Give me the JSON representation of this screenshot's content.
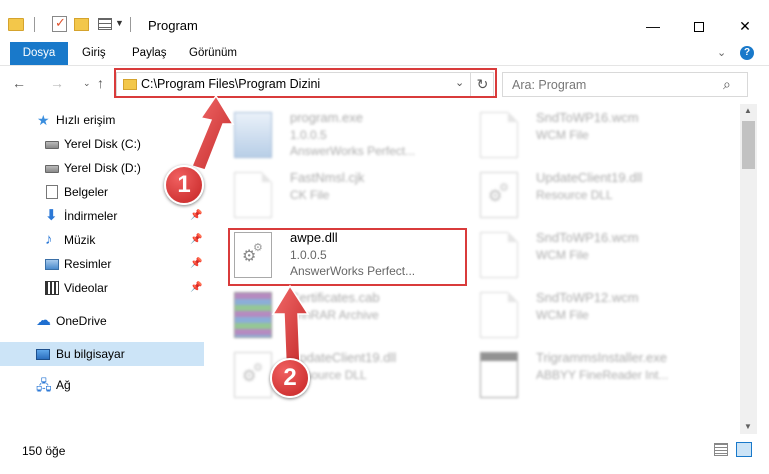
{
  "window": {
    "title": "Program",
    "minimize_glyph": "—",
    "close_glyph": "✕"
  },
  "ribbon": {
    "tabs": [
      "Dosya",
      "Giriş",
      "Paylaş",
      "Görünüm"
    ],
    "help": "?"
  },
  "nav": {
    "address": "C:\\Program Files\\Program Dizini",
    "search_placeholder": "Ara: Program"
  },
  "sidebar": {
    "items": [
      {
        "label": "Hızlı erişim",
        "icon": "star-icon"
      },
      {
        "label": "Yerel Disk (C:)",
        "icon": "disk-icon"
      },
      {
        "label": "Yerel Disk (D:)",
        "icon": "disk-icon"
      },
      {
        "label": "Belgeler",
        "icon": "documents-icon"
      },
      {
        "label": "İndirmeler",
        "icon": "download-icon"
      },
      {
        "label": "Müzik",
        "icon": "music-icon"
      },
      {
        "label": "Resimler",
        "icon": "pictures-icon"
      },
      {
        "label": "Videolar",
        "icon": "video-icon"
      },
      {
        "label": "OneDrive",
        "icon": "cloud-icon"
      },
      {
        "label": "Bu bilgisayar",
        "icon": "computer-icon"
      },
      {
        "label": "Ağ",
        "icon": "network-icon"
      }
    ]
  },
  "files": [
    {
      "name": "program.exe",
      "line1": "1.0.0.5",
      "line2": "AnswerWorks Perfect..."
    },
    {
      "name": "SndToWP16.wcm",
      "line1": "WCM File",
      "line2": ""
    },
    {
      "name": "FastNmsl.cjk",
      "line1": "CK File",
      "line2": ""
    },
    {
      "name": "UpdateClient19.dll",
      "line1": "Resource DLL",
      "line2": ""
    },
    {
      "name": "awpe.dll",
      "line1": "1.0.0.5",
      "line2": "AnswerWorks Perfect..."
    },
    {
      "name": "SndToWP16.wcm",
      "line1": "WCM File",
      "line2": ""
    },
    {
      "name": "Certificates.cab",
      "line1": "WinRAR Archive",
      "line2": ""
    },
    {
      "name": "SndToWP12.wcm",
      "line1": "WCM File",
      "line2": ""
    },
    {
      "name": "UpdateClient19.dll",
      "line1": "Resource DLL",
      "line2": ""
    },
    {
      "name": "TrigrammsInstaller.exe",
      "line1": "ABBYY FineReader Int...",
      "line2": ""
    }
  ],
  "status": {
    "count": "150 öğe"
  },
  "callouts": [
    "1",
    "2"
  ],
  "colors": {
    "accent": "#1979ca",
    "annotation": "#d93b3b",
    "selected": "#cce4f7"
  }
}
